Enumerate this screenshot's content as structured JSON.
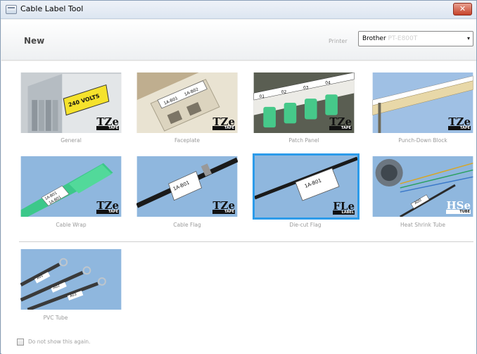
{
  "window": {
    "title": "Cable Label Tool",
    "close_symbol": "✕"
  },
  "header": {
    "title": "New",
    "printer_label": "Printer",
    "printer_value": "Brother",
    "printer_model": "PT-E800T",
    "dropdown_symbol": "▾"
  },
  "tiles": [
    {
      "label": "General",
      "badge": "TZe",
      "badge_sub": "TAPE",
      "image_text": "240 VOLTS"
    },
    {
      "label": "Faceplate",
      "badge": "TZe",
      "badge_sub": "TAPE",
      "image_text_1": "1A-B01",
      "image_text_2": "1A-B02"
    },
    {
      "label": "Patch Panel",
      "badge": "TZe",
      "badge_sub": "TAPE",
      "image_text_1": "01",
      "image_text_2": "02",
      "image_text_3": "03",
      "image_text_4": "04"
    },
    {
      "label": "Punch-Down Block",
      "badge": "TZe",
      "badge_sub": "TAPE"
    },
    {
      "label": "Cable Wrap",
      "badge": "TZe",
      "badge_sub": "TAPE",
      "image_text_1": "1A-B01",
      "image_text_2": "1A-B01"
    },
    {
      "label": "Cable Flag",
      "badge": "TZe",
      "badge_sub": "TAPE",
      "image_text": "1A-B01"
    },
    {
      "label": "Die-cut Flag",
      "badge": "FLe",
      "badge_sub": "LABEL",
      "image_text": "1A-B01"
    },
    {
      "label": "Heat Shrink Tube",
      "badge": "HSe",
      "badge_sub": "TUBE",
      "image_text": "A00"
    },
    {
      "label": "PVC Tube",
      "image_text_1": "A01",
      "image_text_2": "A02",
      "image_text_3": "A03"
    }
  ],
  "footer": {
    "checkbox_label": "Do not show this again.",
    "checkbox_checked": false
  },
  "colors": {
    "selection": "#2c9bea",
    "tile_background": "#8fb7de",
    "cable_green": "#3cc88a"
  }
}
